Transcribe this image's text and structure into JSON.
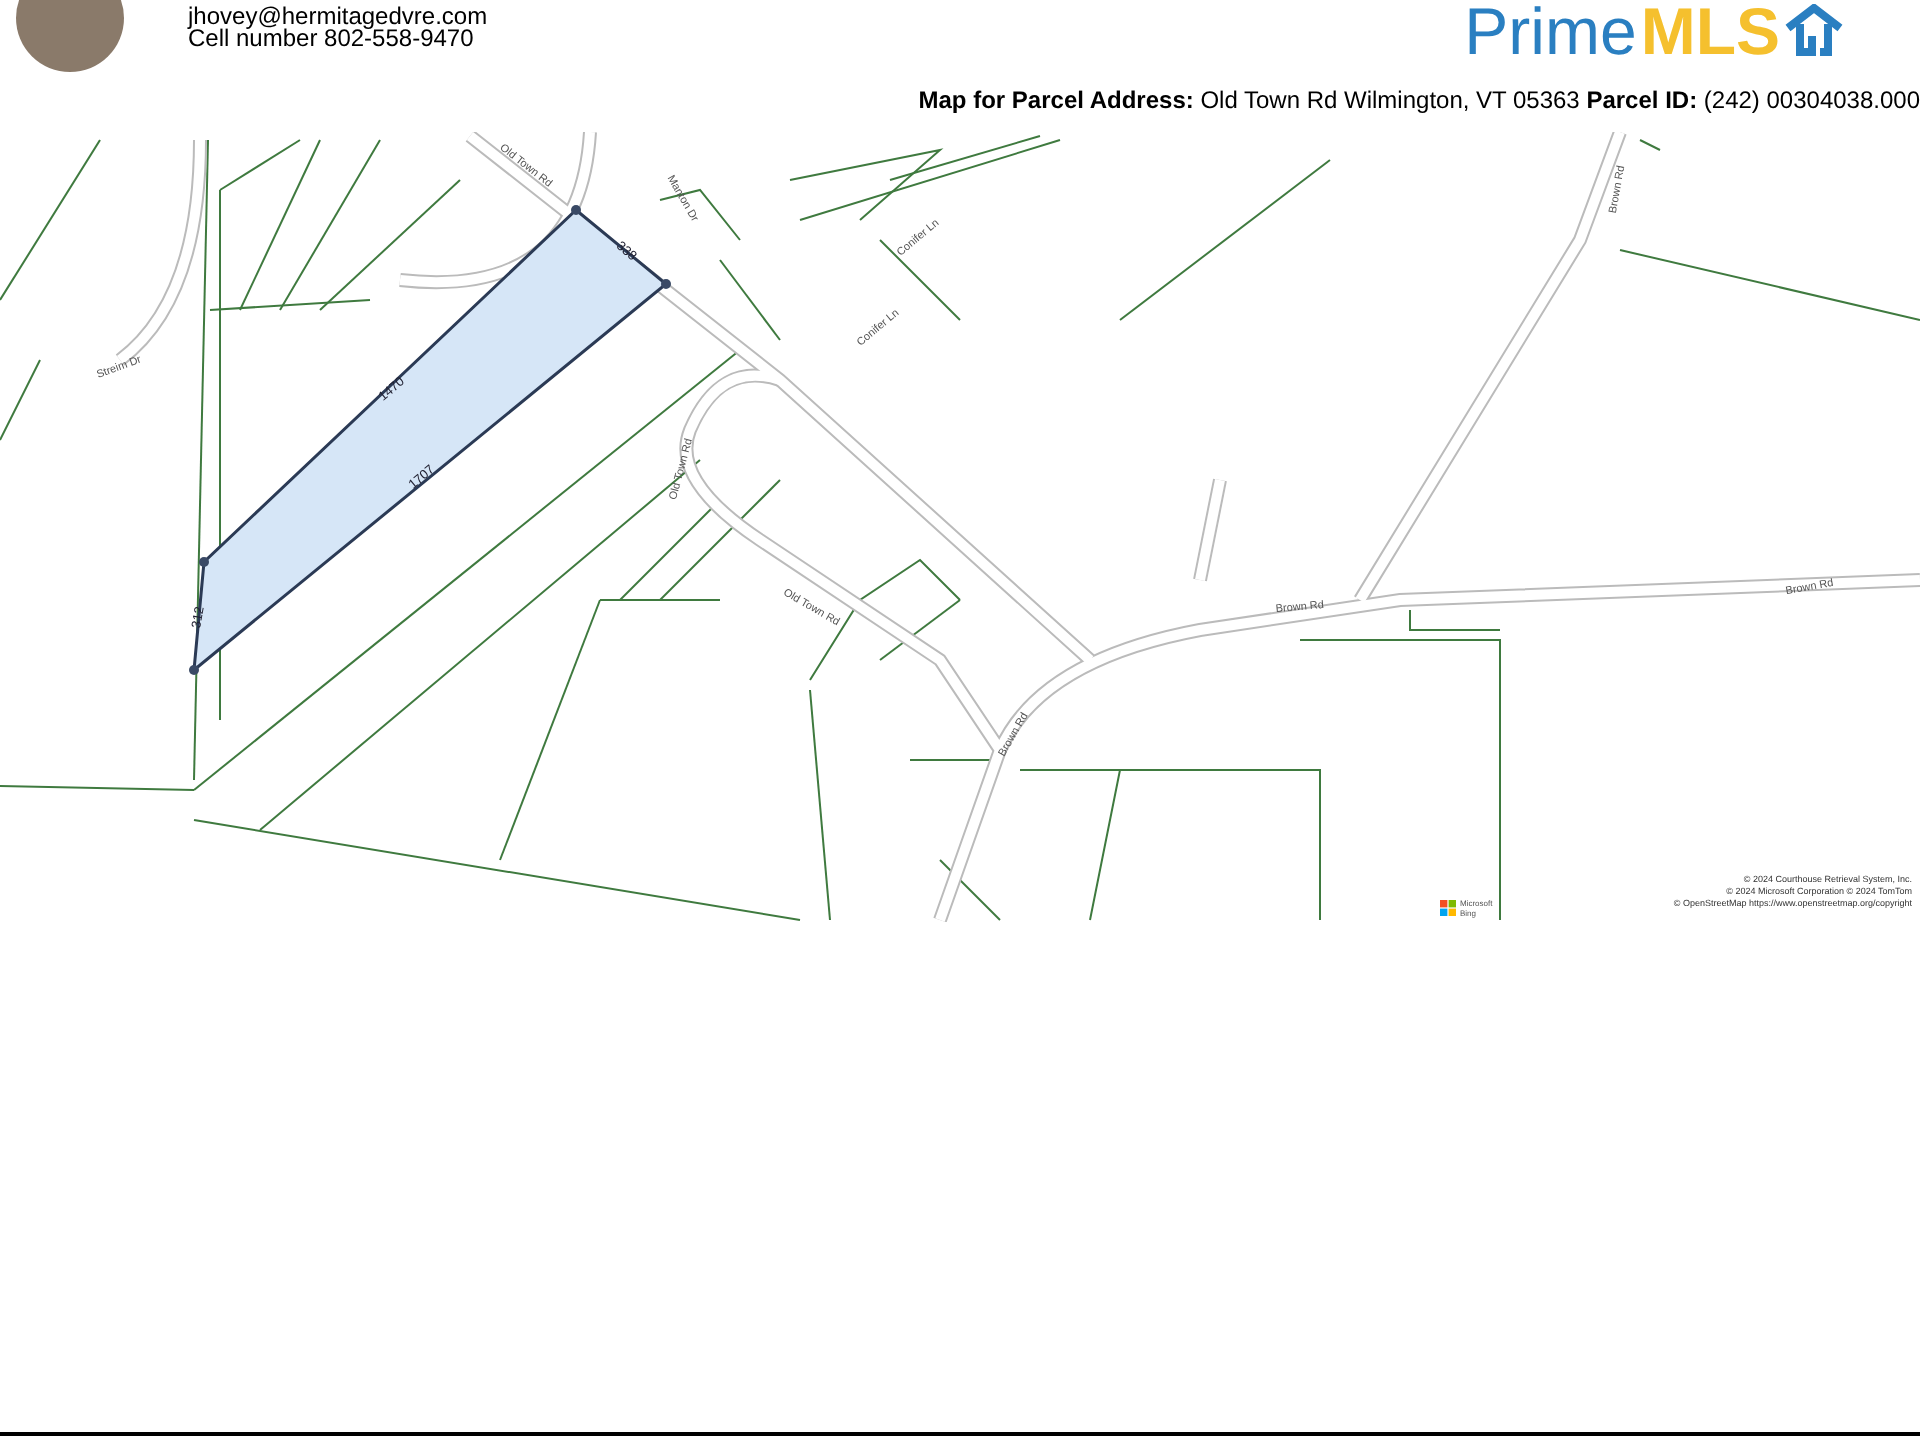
{
  "agent": {
    "email": "jhovey@hermitagedvre.com",
    "cell": "Cell number 802-558-9470"
  },
  "logo": {
    "prime": "Prime",
    "mls": "MLS"
  },
  "map_title": {
    "address_label": "Map for Parcel Address:",
    "address": "Old Town Rd Wilmington, VT 05363",
    "parcel_label": "Parcel ID:",
    "parcel_id": "(242) 00304038.000"
  },
  "map": {
    "road_labels": [
      "Old Town Rd",
      "Manton Dr",
      "Conifer Ln",
      "Conifer Ln",
      "Streim Dr",
      "Old Town Rd",
      "Old Town Rd",
      "Brown Rd",
      "Brown Rd",
      "Brown Rd",
      "Brown Rd"
    ],
    "parcel_dimensions": [
      "338",
      "1470",
      "1707",
      "312"
    ],
    "selected_parcel": {
      "highlighted": true
    },
    "attribution": [
      "© 2024 Courthouse Retrieval System, Inc.",
      "© 2024 Microsoft Corporation © 2024 TomTom",
      "© OpenStreetMap https://www.openstreetmap.org/copyright"
    ],
    "provider": [
      "Microsoft",
      "Bing"
    ]
  }
}
